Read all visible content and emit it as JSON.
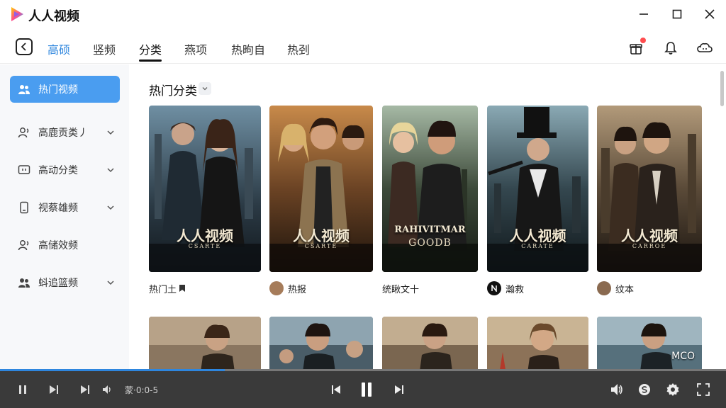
{
  "app": {
    "title": "人人视频"
  },
  "nav": {
    "tabs": [
      "高硕",
      "竖频",
      "分类",
      "燕项",
      "热昫自",
      "热刭"
    ],
    "active_index": 2
  },
  "sidebar": {
    "items": [
      {
        "label": "热门视频",
        "icon": "people-icon",
        "active": true,
        "has_chevron": false
      },
      {
        "label": "高鹿贡类丿",
        "icon": "user-icon",
        "active": false,
        "has_chevron": true
      },
      {
        "label": "高动分类",
        "icon": "tv-icon",
        "active": false,
        "has_chevron": true
      },
      {
        "label": "视蔡雄频",
        "icon": "phone-icon",
        "active": false,
        "has_chevron": true
      },
      {
        "label": "高储效频",
        "icon": "user-icon",
        "active": false,
        "has_chevron": false
      },
      {
        "label": "蚪追篮频",
        "icon": "people-icon",
        "active": false,
        "has_chevron": true
      }
    ]
  },
  "main": {
    "section_title": "热门分类",
    "posters": [
      {
        "title": "人人视频",
        "subtitle": "CSARTE",
        "caption": "热门土",
        "caption_icon": "bookmark-icon"
      },
      {
        "title": "人人视频",
        "subtitle": "CSARTE",
        "caption": "热报",
        "caption_icon": "avatar-icon"
      },
      {
        "title": "RAHIVITMAR",
        "subtitle": "GOODB",
        "caption": "统瞅文十",
        "caption_icon": ""
      },
      {
        "title": "人人视频",
        "subtitle": "CARATE",
        "caption": "瀚救",
        "caption_icon": "n-logo-icon"
      },
      {
        "title": "人人视频",
        "subtitle": "CARROE",
        "caption": "纹本",
        "caption_icon": "avatar-icon"
      }
    ],
    "second_row_overlay": "MCO"
  },
  "player": {
    "time": "蒙·0:0-5",
    "progress": 0.31
  },
  "colors": {
    "accent": "#2e86de",
    "sidebar_active": "#4a9df0",
    "player_bg": "#3a3a3a",
    "notification_dot": "#ff4d4f"
  }
}
